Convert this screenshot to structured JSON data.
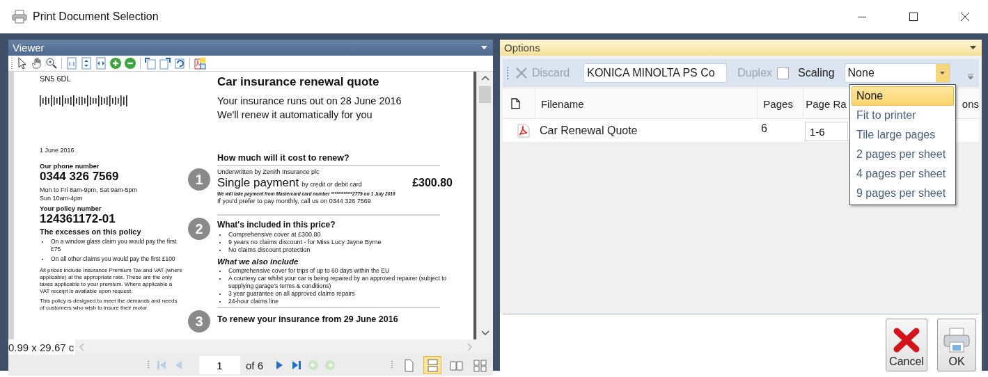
{
  "window": {
    "title": "Print Document Selection"
  },
  "viewer": {
    "title": "Viewer",
    "document": {
      "address": "SN5 6DL",
      "date": "1 June 2016",
      "phone_label": "Our phone number",
      "phone": "0344 326 7569",
      "hours": [
        "Mon to Fri 8am-9pm, Sat 9am-5pm",
        "Sun 10am-4pm"
      ],
      "policy_label": "Your policy number",
      "policy_number": "124361172-01",
      "excesses_title": "The excesses on this policy",
      "excesses": [
        "On a window glass claim you would pay the first £75",
        "On all other claims you would pay the first £100"
      ],
      "notes": [
        "All prices include Insurance Premium Tax and VAT (where applicable) at the appropriate rate. These are the only taxes applicable to your premium. Where applicable a VAT receipt is available upon request.",
        "This policy is designed to meet the demands and needs of customers who wish to insure their motor"
      ],
      "title": "Car insurance renewal quote",
      "subtitle": [
        "Your insurance runs out on 28 June 2016",
        "We'll renew it automatically for you"
      ],
      "cost": {
        "step": "1",
        "heading": "How much will it cost to renew?",
        "underwriter": "Underwritten by Zenith Insurance plc",
        "payment": "Single payment",
        "payment_method": "by credit or debit card",
        "amount": "£300.80",
        "payment_note": "We will take payment from Mastercard card number ************2779 on 1 July 2016",
        "monthly": "If you'd prefer to pay monthly, call us on 0344 326 7569"
      },
      "included": {
        "step": "2",
        "heading": "What's included in this price?",
        "items": [
          "Comprehensive cover at £300.80",
          "9 years no claims discount - for Miss Lucy Jayne Byrne",
          "No claims discount protection"
        ]
      },
      "also": {
        "heading": "What we also include",
        "items": [
          "Comprehensive cover for trips of up to 60 days within the EU",
          "A courtesy car whilst your car is being repaired by an approved repairer (subject to supplying garage's terms & conditions)",
          "3 year guarantee on all approved claims repairs",
          "24-hour claims line"
        ]
      },
      "renew": {
        "step": "3",
        "heading": "To renew your insurance from 29 June 2016"
      }
    },
    "size_readout": "0.99 x 29.67 c",
    "navigator": {
      "buttons": [
        {
          "kind": "first",
          "disabled": true
        },
        {
          "kind": "previous",
          "disabled": true
        }
      ],
      "page": "1",
      "of": "of 6",
      "after": [
        {
          "kind": "next",
          "disabled": false
        },
        {
          "kind": "last",
          "disabled": false
        },
        {
          "kind": "back",
          "disabled": true
        },
        {
          "kind": "forward",
          "disabled": true
        }
      ]
    },
    "view_modes": [
      {
        "kind": "single",
        "selected": false
      },
      {
        "kind": "continuous",
        "selected": true
      },
      {
        "kind": "facing",
        "selected": false
      },
      {
        "kind": "multi",
        "selected": false
      }
    ]
  },
  "options": {
    "title": "Options",
    "discard": {
      "label": "Discard",
      "disabled": true
    },
    "printer": "KONICA MINOLTA PS Co",
    "duplex": {
      "label": "Duplex",
      "checked": false
    },
    "scaling": {
      "label": "Scaling",
      "value": "None",
      "expanded": true,
      "options": [
        {
          "label": "None",
          "selected": true
        },
        {
          "label": "Fit to printer",
          "selected": false
        },
        {
          "label": "Tile large pages",
          "selected": false
        },
        {
          "label": "2 pages per sheet",
          "selected": false
        },
        {
          "label": "4 pages per sheet",
          "selected": false
        },
        {
          "label": "9 pages per sheet",
          "selected": false
        }
      ]
    },
    "columns": [
      "Filename",
      "Pages",
      "Page Ra",
      "ons"
    ],
    "rows": [
      {
        "filename": "Car Renewal Quote",
        "pages": "6",
        "page_range": "1-6"
      }
    ],
    "buttons": [
      {
        "label": "Cancel",
        "kind": "cancel"
      },
      {
        "label": "OK",
        "kind": "ok"
      }
    ]
  }
}
